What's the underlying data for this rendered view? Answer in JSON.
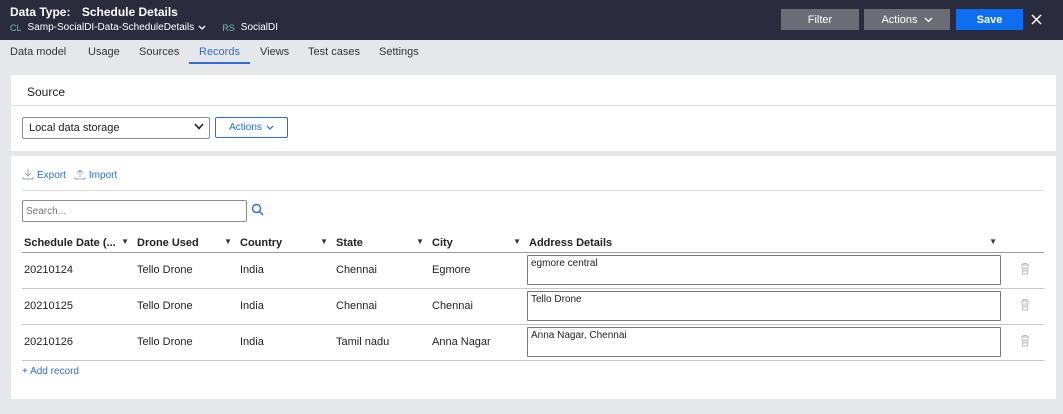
{
  "header": {
    "title_label": "Data Type:",
    "title_value": "Schedule Details",
    "class_tag": "CL",
    "class_value": "Samp-SocialDI-Data-ScheduleDetails",
    "ruleset_tag": "RS",
    "ruleset_value": "SocialDI",
    "filter_label": "Filter",
    "actions_label": "Actions",
    "save_label": "Save",
    "close_icon": "close-icon"
  },
  "tabs": [
    {
      "label": "Data model"
    },
    {
      "label": "Usage"
    },
    {
      "label": "Sources"
    },
    {
      "label": "Records",
      "active": true
    },
    {
      "label": "Views"
    },
    {
      "label": "Test cases"
    },
    {
      "label": "Settings"
    }
  ],
  "source": {
    "title": "Source",
    "storage_value": "Local data storage",
    "actions_label": "Actions"
  },
  "records": {
    "export_label": "Export",
    "import_label": "Import",
    "search_placeholder": "Search...",
    "columns": [
      "Schedule Date (...",
      "Drone Used",
      "Country",
      "State",
      "City",
      "Address Details"
    ],
    "rows": [
      {
        "date": "20210124",
        "drone": "Tello Drone",
        "country": "India",
        "state": "Chennai",
        "city": "Egmore",
        "address": "egmore central"
      },
      {
        "date": "20210125",
        "drone": "Tello Drone",
        "country": "India",
        "state": "Chennai",
        "city": "Chennai",
        "address": "Tello Drone"
      },
      {
        "date": "20210126",
        "drone": "Tello Drone",
        "country": "India",
        "state": "Tamil nadu",
        "city": "Anna Nagar",
        "address": "Anna Nagar, Chennai"
      }
    ],
    "add_record_label": "+ Add record"
  },
  "colors": {
    "header_bg": "#2a2c3e",
    "accent": "#2a6fd3",
    "save_bg": "#0d6ef0"
  }
}
